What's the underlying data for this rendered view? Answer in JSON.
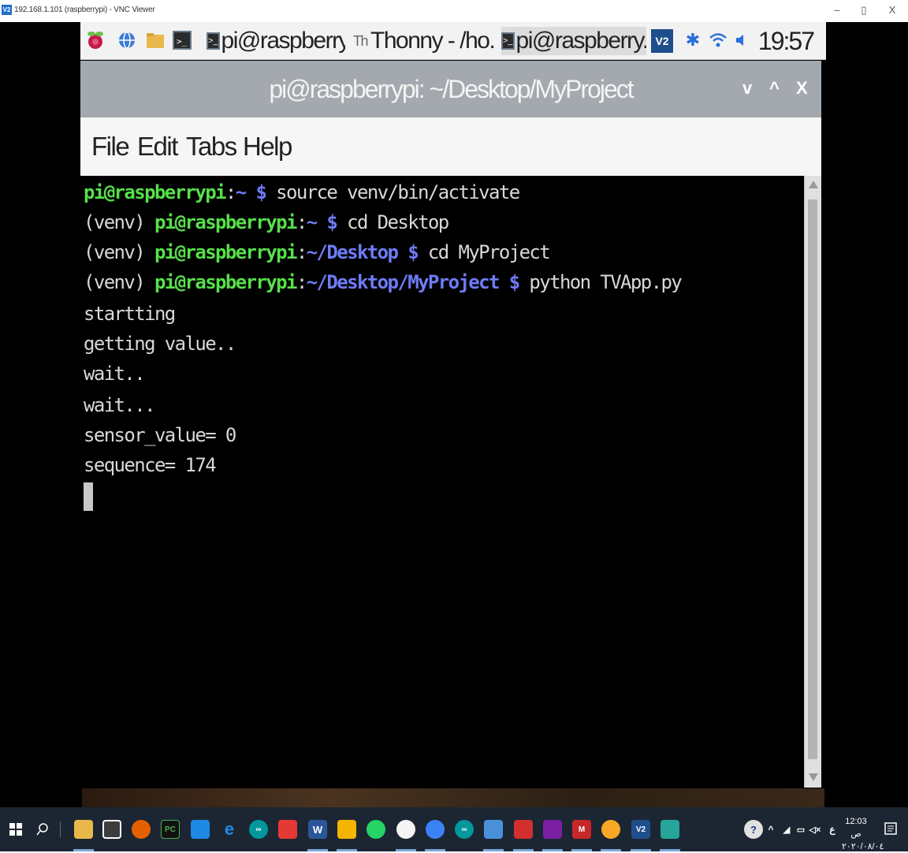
{
  "vnc": {
    "logo": "V2",
    "title": "192.168.1.101 (raspberrypi) - VNC Viewer",
    "minimize": "–",
    "maximize": "▯",
    "close": "X"
  },
  "pi_panel": {
    "tasks": [
      {
        "label": "pi@raspberry...",
        "icon": "terminal-icon"
      },
      {
        "label": "Thonny - /ho...",
        "icon": "thonny-icon"
      },
      {
        "label": "pi@raspberry...",
        "icon": "terminal-icon"
      }
    ],
    "clock": "19:57"
  },
  "terminal": {
    "title": "pi@raspberrypi: ~/Desktop/MyProject",
    "controls": {
      "min": "v",
      "max": "^",
      "close": "X"
    },
    "menu": [
      "File",
      "Edit",
      "Tabs",
      "Help"
    ],
    "lines": [
      {
        "venv": "",
        "user": "pi@raspberrypi",
        "sep": ":",
        "path": "~",
        "prompt": " $ ",
        "cmd": "source venv/bin/activate"
      },
      {
        "venv": "(venv) ",
        "user": "pi@raspberrypi",
        "sep": ":",
        "path": "~",
        "prompt": " $ ",
        "cmd": "cd Desktop"
      },
      {
        "venv": "(venv) ",
        "user": "pi@raspberrypi",
        "sep": ":",
        "path": "~/Desktop",
        "prompt": " $ ",
        "cmd": "cd MyProject"
      },
      {
        "venv": "(venv) ",
        "user": "pi@raspberrypi",
        "sep": ":",
        "path": "~/Desktop/MyProject",
        "prompt": " $ ",
        "cmd": "python TVApp.py"
      }
    ],
    "output": [
      "startting",
      "getting value..",
      "wait..",
      "wait...",
      "sensor_value= 0",
      "sequence= 174"
    ]
  },
  "win_taskbar": {
    "clock_time": "12:03 ص",
    "clock_date": "٢٠٢٠/٠٨/٠٤",
    "lang": "ع"
  },
  "colors": {
    "prompt_user": "#56e04a",
    "prompt_path": "#6e7cf6",
    "terminal_bg": "#000000",
    "titlebar": "#a3a9ae"
  }
}
